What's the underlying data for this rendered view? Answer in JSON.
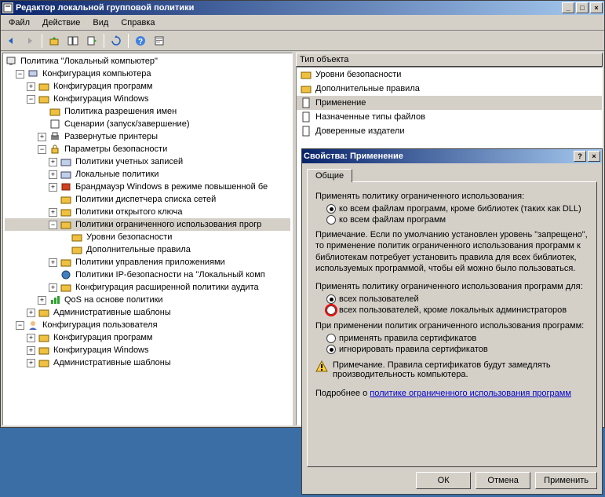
{
  "window": {
    "title": "Редактор локальной групповой политики"
  },
  "menu": {
    "file": "Файл",
    "action": "Действие",
    "view": "Вид",
    "help": "Справка"
  },
  "tree": {
    "root": "Политика \"Локальный компьютер\"",
    "comp_config": "Конфигурация компьютера",
    "software_config": "Конфигурация программ",
    "windows_config": "Конфигурация Windows",
    "name_res_policy": "Политика разрешения имен",
    "scripts": "Сценарии (запуск/завершение)",
    "deployed_printers": "Развернутые принтеры",
    "security_settings": "Параметры безопасности",
    "account_policies": "Политики учетных записей",
    "local_policies": "Локальные политики",
    "firewall": "Брандмауэр Windows в режиме повышенной бе",
    "nlm_policies": "Политики диспетчера списка сетей",
    "pubkey_policies": "Политики открытого ключа",
    "srp": "Политики ограниченного использования прогр",
    "security_levels": "Уровни безопасности",
    "additional_rules": "Дополнительные правила",
    "appctrl_policies": "Политики управления приложениями",
    "ipsec": "Политики IP-безопасности на \"Локальный комп",
    "advaudit": "Конфигурация расширенной политики аудита",
    "qos": "QoS на основе политики",
    "admin_templates": "Административные шаблоны",
    "user_config": "Конфигурация пользователя",
    "u_software": "Конфигурация программ",
    "u_windows": "Конфигурация Windows",
    "u_admin_templates": "Административные шаблоны"
  },
  "list": {
    "header": "Тип объекта",
    "items": [
      "Уровни безопасности",
      "Дополнительные правила",
      "Применение",
      "Назначенные типы файлов",
      "Доверенные издатели"
    ]
  },
  "dialog": {
    "title": "Свойства: Применение",
    "tab_general": "Общие",
    "section1": "Применять политику ограниченного использования:",
    "opt1a": "ко всем файлам программ, кроме библиотек (таких как DLL)",
    "opt1b": "ко всем файлам программ",
    "note1": "Примечание. Если по умолчанию установлен уровень \"запрещено\", то применение политик ограниченного использования программ к библиотекам потребует установить правила для всех библиотек, используемых программой, чтобы ей можно было пользоваться.",
    "section2": "Применять политику ограниченного использования программ для:",
    "opt2a": "всех пользователей",
    "opt2b": "всех пользователей, кроме локальных администраторов",
    "section3": "При применении политик ограниченного использования программ:",
    "opt3a": "применять правила сертификатов",
    "opt3b": "игнорировать правила сертификатов",
    "note2": "Примечание. Правила сертификатов будут замедлять производительность компьютера.",
    "more_prefix": "Подробнее о ",
    "more_link": "политике ограниченного использования программ",
    "ok": "ОК",
    "cancel": "Отмена",
    "apply": "Применить"
  }
}
